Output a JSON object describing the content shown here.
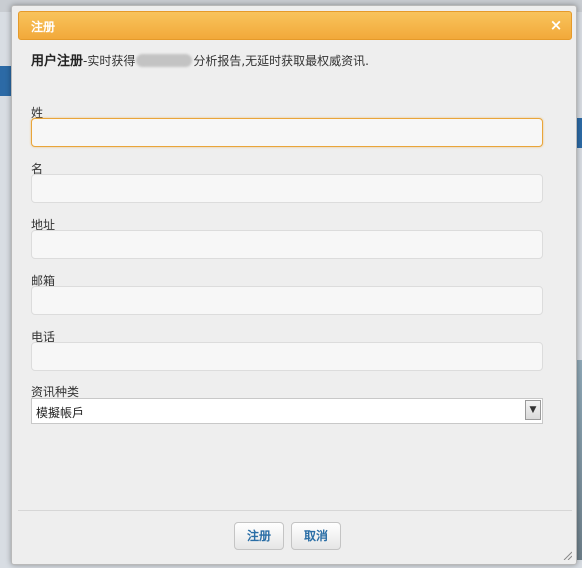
{
  "dialog": {
    "title": "注册",
    "close_glyph": "×",
    "intro_bold": "用户注册",
    "intro_before": "-实时获得",
    "intro_after": "分析报告,无延时获取最权威资讯."
  },
  "fields": {
    "surname": {
      "label": "姓",
      "value": ""
    },
    "given_name": {
      "label": "名",
      "value": ""
    },
    "address": {
      "label": "地址",
      "value": ""
    },
    "email": {
      "label": "邮箱",
      "value": ""
    },
    "phone": {
      "label": "电话",
      "value": ""
    },
    "info_type": {
      "label": "资讯种类",
      "selected": "模擬帳戶"
    }
  },
  "buttons": {
    "register": "注册",
    "cancel": "取消"
  },
  "colors": {
    "titlebar_accent": "#f2a93a",
    "button_text": "#2a6ea6",
    "focus_border": "#e9a53a"
  }
}
